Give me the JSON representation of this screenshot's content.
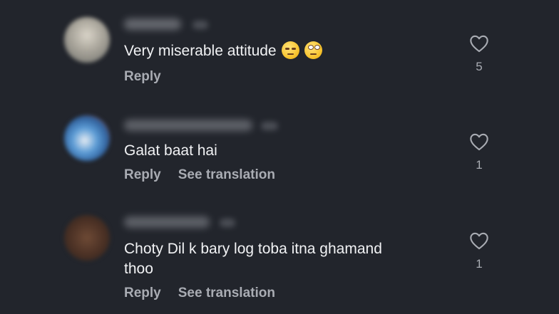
{
  "colors": {
    "background": "#22252c",
    "text": "#f1f2f4",
    "secondary": "#a9acb3"
  },
  "comments": [
    {
      "text": "Very miserable attitude",
      "emojis": [
        "unamused-face-emoji",
        "face-with-rolling-eyes-emoji"
      ],
      "reply_label": "Reply",
      "like_icon": "heart-outline-icon",
      "like_count": "5"
    },
    {
      "text": "Galat baat hai",
      "reply_label": "Reply",
      "translation_label": "See translation",
      "like_icon": "heart-outline-icon",
      "like_count": "1"
    },
    {
      "text_line1": "Choty Dil k bary log toba itna ghamand",
      "text_line2": "thoo",
      "reply_label": "Reply",
      "translation_label": "See translation",
      "like_icon": "heart-outline-icon",
      "like_count": "1"
    }
  ]
}
